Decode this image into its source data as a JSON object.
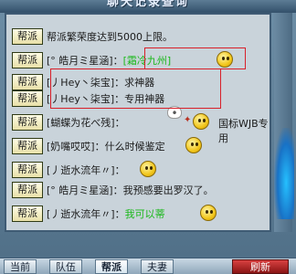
{
  "window": {
    "title": "聊天记录查询"
  },
  "messages": [
    {
      "channel": "帮派",
      "text": "帮派繁荣度达到5000上限。",
      "emphasis": ""
    },
    {
      "channel": "帮派",
      "text": "[° 皓月ミ星涵]：",
      "emphasis": "[霜冷九州]"
    },
    {
      "channel": "帮派",
      "text": "[丿Hey丶柒宝]：求神器",
      "emphasis": ""
    },
    {
      "channel": "帮派",
      "text": "[丿Hey丶柒宝]：专用神器",
      "emphasis": ""
    },
    {
      "channel": "帮派",
      "text": "[蝴蝶为花べ残]：",
      "emphasis": "",
      "suffix": "国标WJB专用"
    },
    {
      "channel": "帮派",
      "text": "[奶嘴哎哎]：什么时候鉴定",
      "emphasis": ""
    },
    {
      "channel": "帮派",
      "text": "[丿逝水流年〃]：",
      "emphasis": ""
    },
    {
      "channel": "帮派",
      "text": "[° 皓月ミ星涵]：我预感要出罗汉了。",
      "emphasis": ""
    },
    {
      "channel": "帮派",
      "text": "[丿逝水流年〃]：",
      "emphasis": "我可以蒂"
    }
  ],
  "tabs": [
    {
      "label": "当前"
    },
    {
      "label": "队伍"
    },
    {
      "label": "帮派"
    },
    {
      "label": "夫妻"
    },
    {
      "label": "刷新"
    }
  ],
  "colors": {
    "accent": "#d8202a",
    "highlight_text": "#1bb81b",
    "panel_bg": "#c9d3da"
  }
}
